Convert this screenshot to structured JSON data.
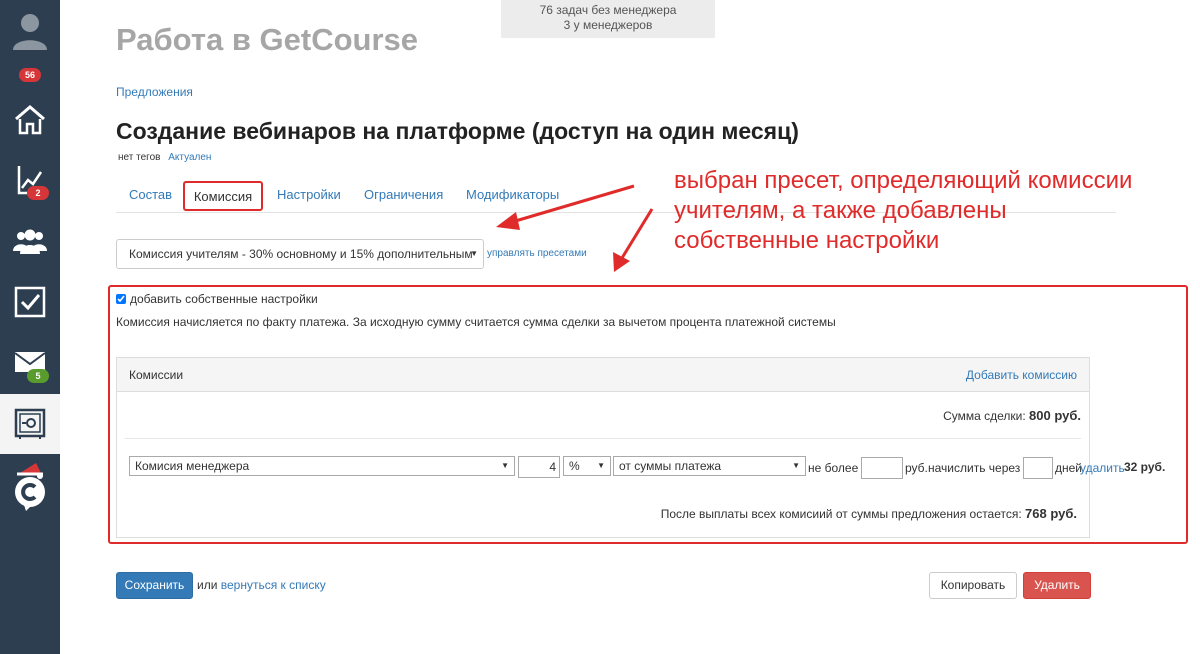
{
  "sidebar": {
    "items": [
      {
        "icon": "user-avatar-icon",
        "badge": "56",
        "badge_color": "#d63638"
      },
      {
        "icon": "home-icon"
      },
      {
        "icon": "chart-icon",
        "badge": "2",
        "badge_color": "#d63638"
      },
      {
        "icon": "users-icon"
      },
      {
        "icon": "checkbox-icon"
      },
      {
        "icon": "mail-icon",
        "badge": "5",
        "badge_color": "#5a9b2e"
      },
      {
        "icon": "safe-icon",
        "active": true
      },
      {
        "icon": "getcourse-logo-icon"
      }
    ]
  },
  "notice": {
    "line1": "76 задач без менеджера",
    "line2": "3 у менеджеров"
  },
  "header": {
    "app_title": "Работа в GetCourse"
  },
  "breadcrumb": "Предложения",
  "page": {
    "title": "Создание вебинаров на платформе (доступ на один месяц)",
    "tags_label": "нет тегов",
    "status_link": "Актуален"
  },
  "tabs": [
    {
      "label": "Состав"
    },
    {
      "label": "Комиссия",
      "active": true
    },
    {
      "label": "Настройки"
    },
    {
      "label": "Ограничения"
    },
    {
      "label": "Модификаторы"
    }
  ],
  "annotation": {
    "line1": "выбран пресет, определяющий комиссии",
    "line2": "учителям, а также добавлены",
    "line3": "собственные настройки",
    "color": "#e02b2b"
  },
  "preset": {
    "selected": "Комиссия учителям - 30% основному и 15% дополнительным",
    "manage_link": "управлять пресетами"
  },
  "own_settings": {
    "checked": true,
    "label": "добавить собственные настройки",
    "note": "Комиссия начисляется по факту платежа. За исходную сумму считается сумма сделки за вычетом процента платежной системы"
  },
  "commissions": {
    "title": "Комиссии",
    "add_link": "Добавить комиссию",
    "deal_sum_label": "Сумма сделки:",
    "deal_sum_value": "800 руб.",
    "row": {
      "recipient": "Комисия менеджера",
      "amount": "4",
      "unit": "%",
      "base": "от суммы платежа",
      "no_more_label": "не более",
      "no_more_value": "",
      "rub_label": "руб.",
      "charge_label": "начислить через",
      "days_value": "",
      "days_label": "дней",
      "delete_link": "удалить",
      "total": "32 руб."
    },
    "remain_label": "После выплаты всех комисиий от суммы предложения остается:",
    "remain_value": "768 руб."
  },
  "actions": {
    "save": "Сохранить",
    "or_text": "или",
    "back_link": "вернуться к списку",
    "copy": "Копировать",
    "delete": "Удалить"
  },
  "colors": {
    "sidebar": "#2d3e50",
    "link": "#337ab7",
    "primary": "#337ab7",
    "danger": "#d9534f",
    "highlight": "#e02b2b"
  }
}
